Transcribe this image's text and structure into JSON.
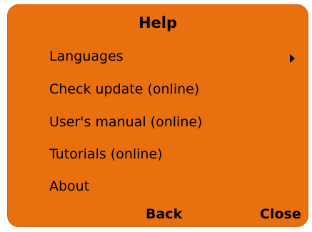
{
  "dialog": {
    "title": "Help",
    "items": [
      {
        "label": "Languages",
        "has_submenu": true
      },
      {
        "label": "Check update (online)",
        "has_submenu": false
      },
      {
        "label": "User's manual (online)",
        "has_submenu": false
      },
      {
        "label": "Tutorials (online)",
        "has_submenu": false
      },
      {
        "label": "About",
        "has_submenu": false
      }
    ],
    "back_label": "Back",
    "close_label": "Close"
  },
  "colors": {
    "panel_background": "#e8700f",
    "text": "#000000"
  },
  "icons": {
    "submenu": "chevron-right-icon"
  }
}
